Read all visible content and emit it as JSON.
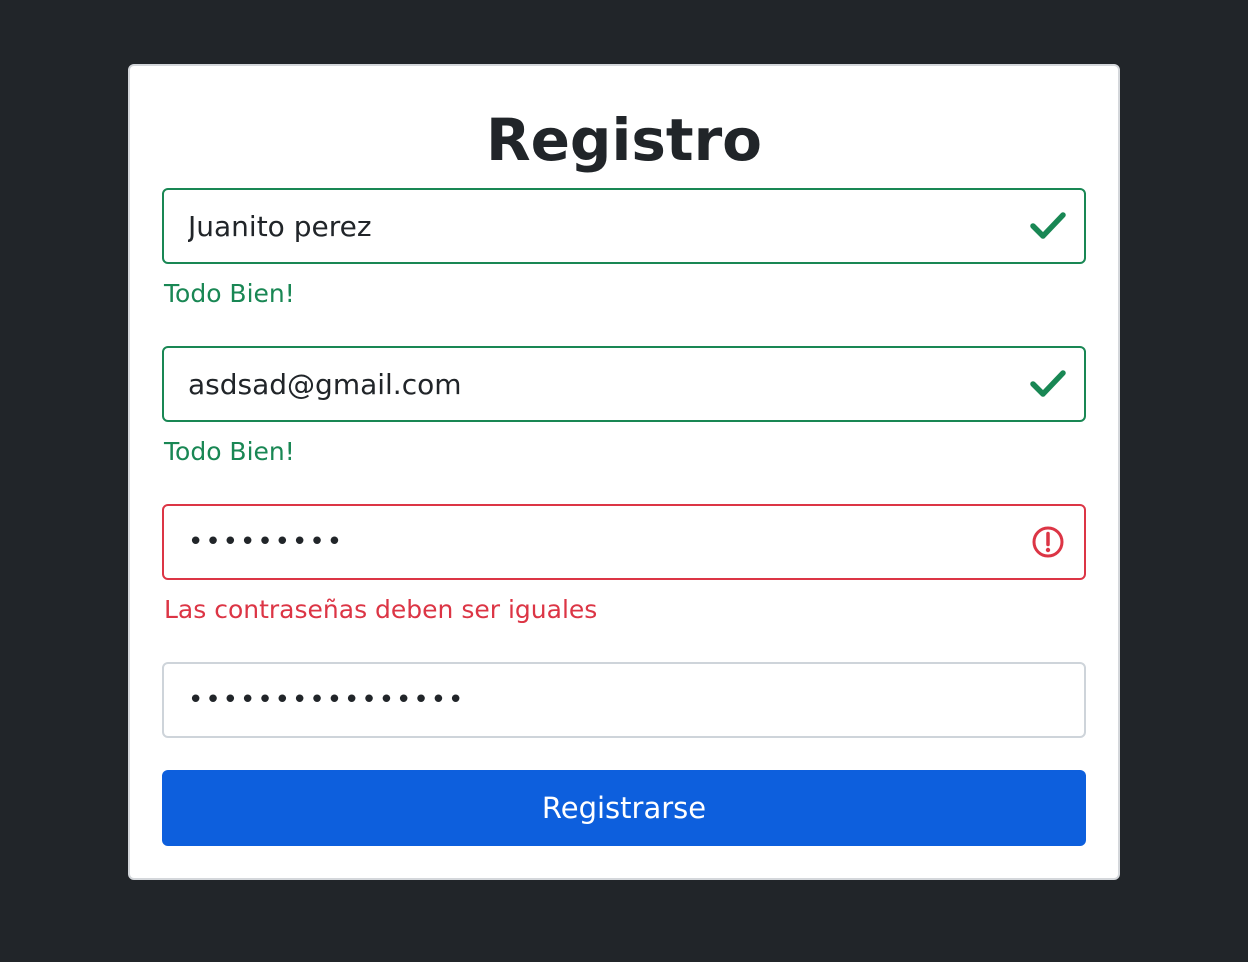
{
  "form": {
    "title": "Registro",
    "name": {
      "value": "Juanito perez",
      "status": "valid",
      "status_icon": "check-icon",
      "feedback": "Todo Bien!"
    },
    "email": {
      "value": "asdsad@gmail.com",
      "status": "valid",
      "status_icon": "check-icon",
      "feedback": "Todo Bien!"
    },
    "password": {
      "masked_value": "•••••••••",
      "status": "invalid",
      "status_icon": "exclamation-circle-icon",
      "feedback": "Las contraseñas deben ser iguales"
    },
    "confirm_password": {
      "masked_value": "••••••••••••••••"
    },
    "submit_label": "Registrarse"
  },
  "colors": {
    "page_background": "#212529",
    "card_background": "#ffffff",
    "valid": "#198754",
    "invalid": "#dc3545",
    "primary": "#0d5fdd"
  }
}
